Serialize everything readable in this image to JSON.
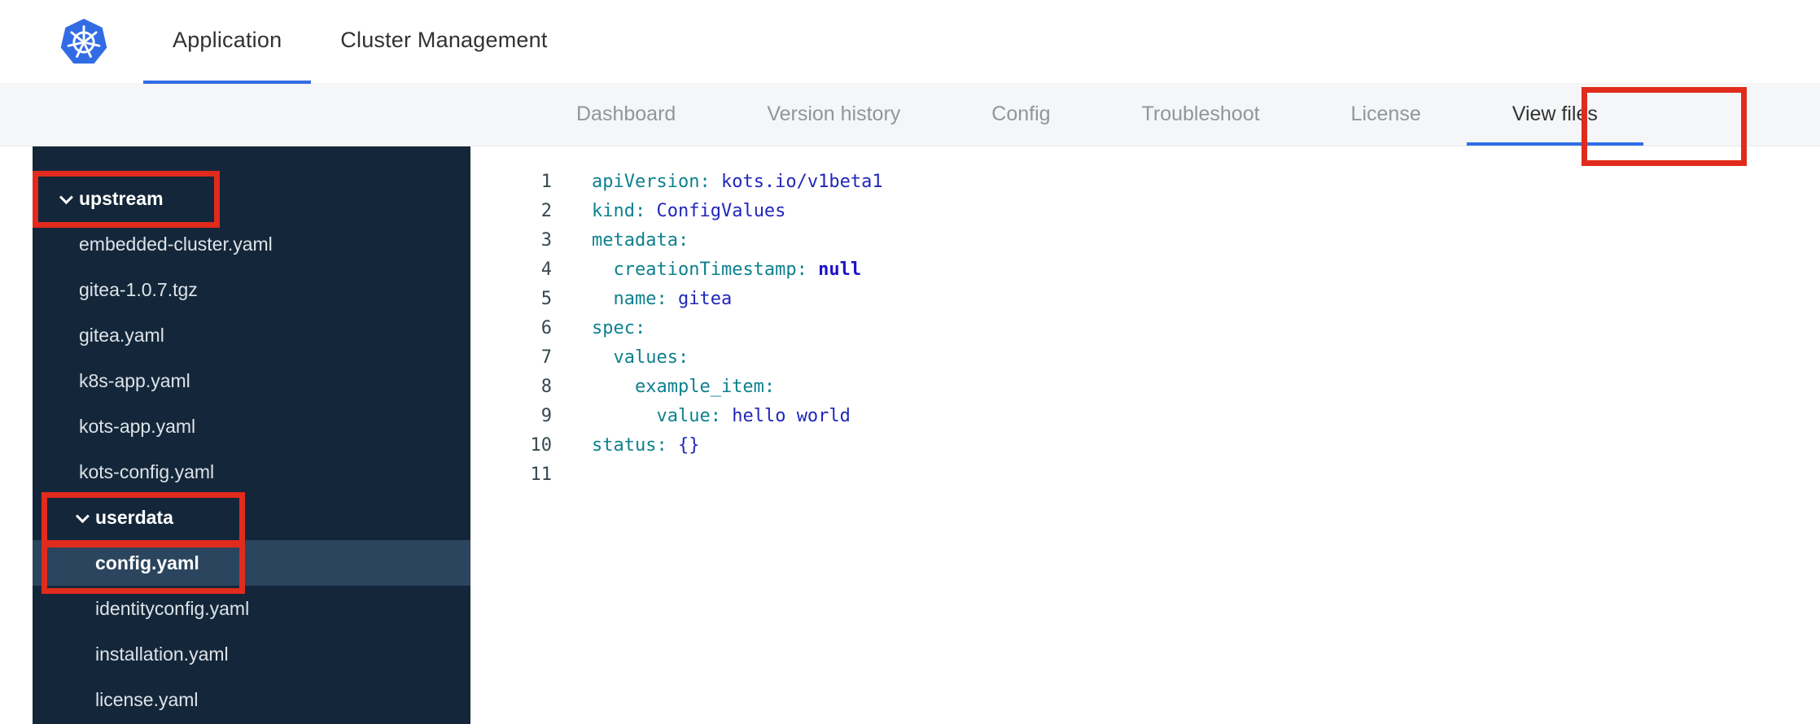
{
  "colors": {
    "accent_blue": "#326de6",
    "annotation_red": "#e02b1d",
    "sidebar_bg": "#14273a",
    "sidebar_selected": "#2b455e",
    "code_key_teal": "#0e808e",
    "code_value_navy": "#2127b9"
  },
  "topbar": {
    "logo": "kubernetes-logo",
    "tabs": [
      {
        "label": "Application",
        "active": true
      },
      {
        "label": "Cluster Management",
        "active": false
      }
    ]
  },
  "subnav": {
    "items": [
      {
        "label": "Dashboard",
        "active": false
      },
      {
        "label": "Version history",
        "active": false
      },
      {
        "label": "Config",
        "active": false
      },
      {
        "label": "Troubleshoot",
        "active": false
      },
      {
        "label": "License",
        "active": false
      },
      {
        "label": "View files",
        "active": true,
        "annotated": true
      }
    ]
  },
  "filetree": {
    "items": [
      {
        "label": "upstream",
        "type": "folder",
        "depth": 0,
        "expanded": true,
        "annotated": true,
        "selected": false
      },
      {
        "label": "embedded-cluster.yaml",
        "type": "file",
        "depth": 1,
        "selected": false
      },
      {
        "label": "gitea-1.0.7.tgz",
        "type": "file",
        "depth": 1,
        "selected": false
      },
      {
        "label": "gitea.yaml",
        "type": "file",
        "depth": 1,
        "selected": false
      },
      {
        "label": "k8s-app.yaml",
        "type": "file",
        "depth": 1,
        "selected": false
      },
      {
        "label": "kots-app.yaml",
        "type": "file",
        "depth": 1,
        "selected": false
      },
      {
        "label": "kots-config.yaml",
        "type": "file",
        "depth": 1,
        "selected": false
      },
      {
        "label": "userdata",
        "type": "folder",
        "depth": 1,
        "expanded": true,
        "annotated": true,
        "selected": false
      },
      {
        "label": "config.yaml",
        "type": "file",
        "depth": 2,
        "selected": true,
        "annotated": true
      },
      {
        "label": "identityconfig.yaml",
        "type": "file",
        "depth": 2,
        "selected": false
      },
      {
        "label": "installation.yaml",
        "type": "file",
        "depth": 2,
        "selected": false
      },
      {
        "label": "license.yaml",
        "type": "file",
        "depth": 2,
        "selected": false
      }
    ]
  },
  "editor": {
    "language": "yaml",
    "lines": [
      {
        "num": 1,
        "tokens": [
          {
            "t": "key",
            "v": "apiVersion:"
          },
          {
            "t": "plain",
            "v": " "
          },
          {
            "t": "value",
            "v": "kots.io/v1beta1"
          }
        ]
      },
      {
        "num": 2,
        "tokens": [
          {
            "t": "key",
            "v": "kind:"
          },
          {
            "t": "plain",
            "v": " "
          },
          {
            "t": "value",
            "v": "ConfigValues"
          }
        ]
      },
      {
        "num": 3,
        "tokens": [
          {
            "t": "key",
            "v": "metadata:"
          }
        ]
      },
      {
        "num": 4,
        "tokens": [
          {
            "t": "plain",
            "v": "  "
          },
          {
            "t": "key",
            "v": "creationTimestamp:"
          },
          {
            "t": "plain",
            "v": " "
          },
          {
            "t": "keyword",
            "v": "null"
          }
        ]
      },
      {
        "num": 5,
        "tokens": [
          {
            "t": "plain",
            "v": "  "
          },
          {
            "t": "key",
            "v": "name:"
          },
          {
            "t": "plain",
            "v": " "
          },
          {
            "t": "value",
            "v": "gitea"
          }
        ]
      },
      {
        "num": 6,
        "tokens": [
          {
            "t": "key",
            "v": "spec:"
          }
        ]
      },
      {
        "num": 7,
        "tokens": [
          {
            "t": "plain",
            "v": "  "
          },
          {
            "t": "key",
            "v": "values:"
          }
        ]
      },
      {
        "num": 8,
        "tokens": [
          {
            "t": "plain",
            "v": "    "
          },
          {
            "t": "key",
            "v": "example_item:"
          }
        ]
      },
      {
        "num": 9,
        "tokens": [
          {
            "t": "plain",
            "v": "      "
          },
          {
            "t": "key",
            "v": "value:"
          },
          {
            "t": "plain",
            "v": " "
          },
          {
            "t": "value",
            "v": "hello world"
          }
        ]
      },
      {
        "num": 10,
        "tokens": [
          {
            "t": "key",
            "v": "status:"
          },
          {
            "t": "plain",
            "v": " "
          },
          {
            "t": "value",
            "v": "{}"
          }
        ]
      },
      {
        "num": 11,
        "tokens": []
      }
    ]
  },
  "annotations": [
    {
      "target": "view-files-tab"
    },
    {
      "target": "upstream-folder"
    },
    {
      "target": "userdata-folder"
    },
    {
      "target": "config-yaml-file"
    }
  ]
}
